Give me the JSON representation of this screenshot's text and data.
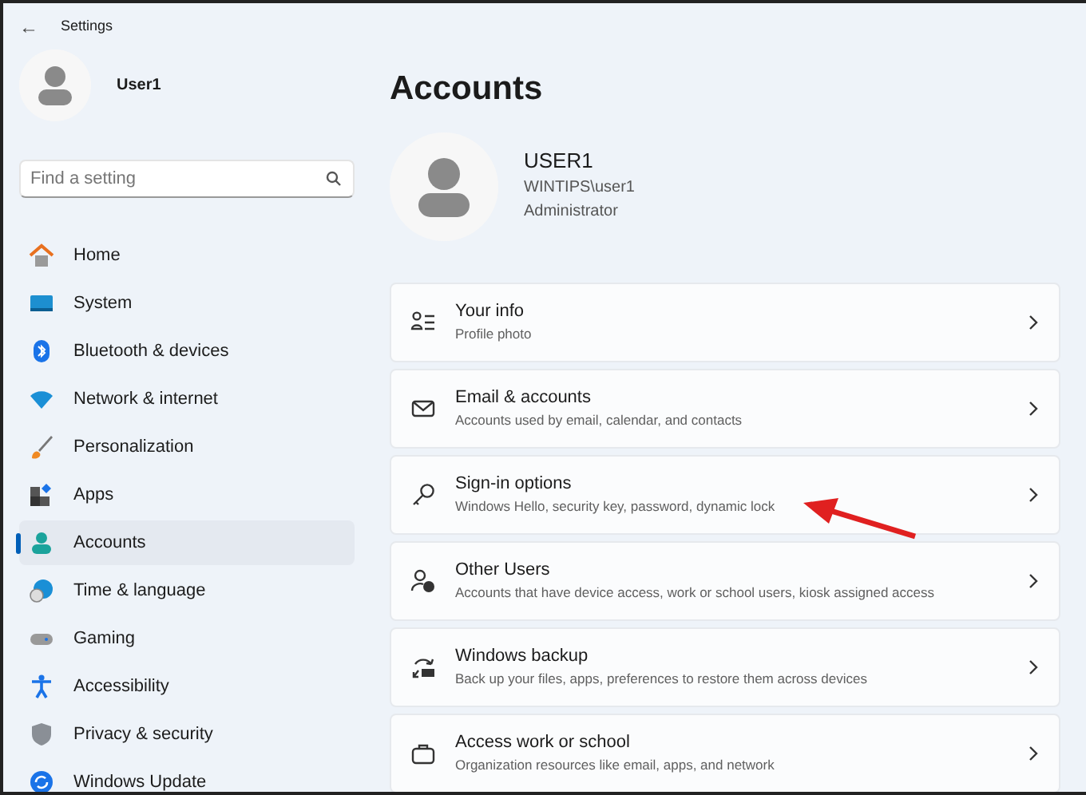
{
  "window": {
    "title": "Settings",
    "back": "←"
  },
  "sidebar": {
    "user": "User1",
    "search": {
      "placeholder": "Find a setting"
    },
    "items": [
      {
        "label": "Home",
        "selected": false
      },
      {
        "label": "System",
        "selected": false
      },
      {
        "label": "Bluetooth & devices",
        "selected": false
      },
      {
        "label": "Network & internet",
        "selected": false
      },
      {
        "label": "Personalization",
        "selected": false
      },
      {
        "label": "Apps",
        "selected": false
      },
      {
        "label": "Accounts",
        "selected": true
      },
      {
        "label": "Time & language",
        "selected": false
      },
      {
        "label": "Gaming",
        "selected": false
      },
      {
        "label": "Accessibility",
        "selected": false
      },
      {
        "label": "Privacy & security",
        "selected": false
      },
      {
        "label": "Windows Update",
        "selected": false
      }
    ]
  },
  "page": {
    "title": "Accounts",
    "account": {
      "name": "USER1",
      "login": "WINTIPS\\user1",
      "role": "Administrator"
    },
    "cards": [
      {
        "title": "Your info",
        "subtitle": "Profile photo",
        "highlighted": false
      },
      {
        "title": "Email & accounts",
        "subtitle": "Accounts used by email, calendar, and contacts",
        "highlighted": false
      },
      {
        "title": "Sign-in options",
        "subtitle": "Windows Hello, security key, password, dynamic lock",
        "highlighted": true
      },
      {
        "title": "Other Users",
        "subtitle": "Accounts that have device access, work or school users, kiosk assigned access",
        "highlighted": false
      },
      {
        "title": "Windows backup",
        "subtitle": "Back up your files, apps, preferences to restore them across devices",
        "highlighted": false
      },
      {
        "title": "Access work or school",
        "subtitle": "Organization resources like email, apps, and network",
        "highlighted": false
      }
    ]
  }
}
